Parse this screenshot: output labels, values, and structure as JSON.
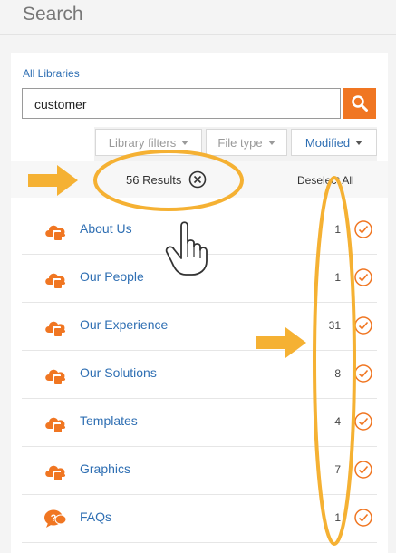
{
  "header": {
    "title": "Search"
  },
  "libraries_link": "All Libraries",
  "search": {
    "value": "customer"
  },
  "filters": {
    "library": "Library filters",
    "file_type": "File type",
    "modified": "Modified"
  },
  "results": {
    "summary": "56 Results",
    "deselect_all": "Deselect All"
  },
  "items": [
    {
      "label": "About Us",
      "count": "1",
      "icon": "cloud-folder-icon"
    },
    {
      "label": "Our People",
      "count": "1",
      "icon": "cloud-folder-icon"
    },
    {
      "label": "Our Experience",
      "count": "31",
      "icon": "cloud-folder-icon"
    },
    {
      "label": "Our Solutions",
      "count": "8",
      "icon": "cloud-folder-icon"
    },
    {
      "label": "Templates",
      "count": "4",
      "icon": "cloud-folder-icon"
    },
    {
      "label": "Graphics",
      "count": "7",
      "icon": "cloud-folder-icon"
    },
    {
      "label": "FAQs",
      "count": "1",
      "icon": "question-chat-icon"
    }
  ],
  "colors": {
    "accent": "#f07622",
    "link": "#2f6fb3",
    "highlight": "#f5b133"
  }
}
